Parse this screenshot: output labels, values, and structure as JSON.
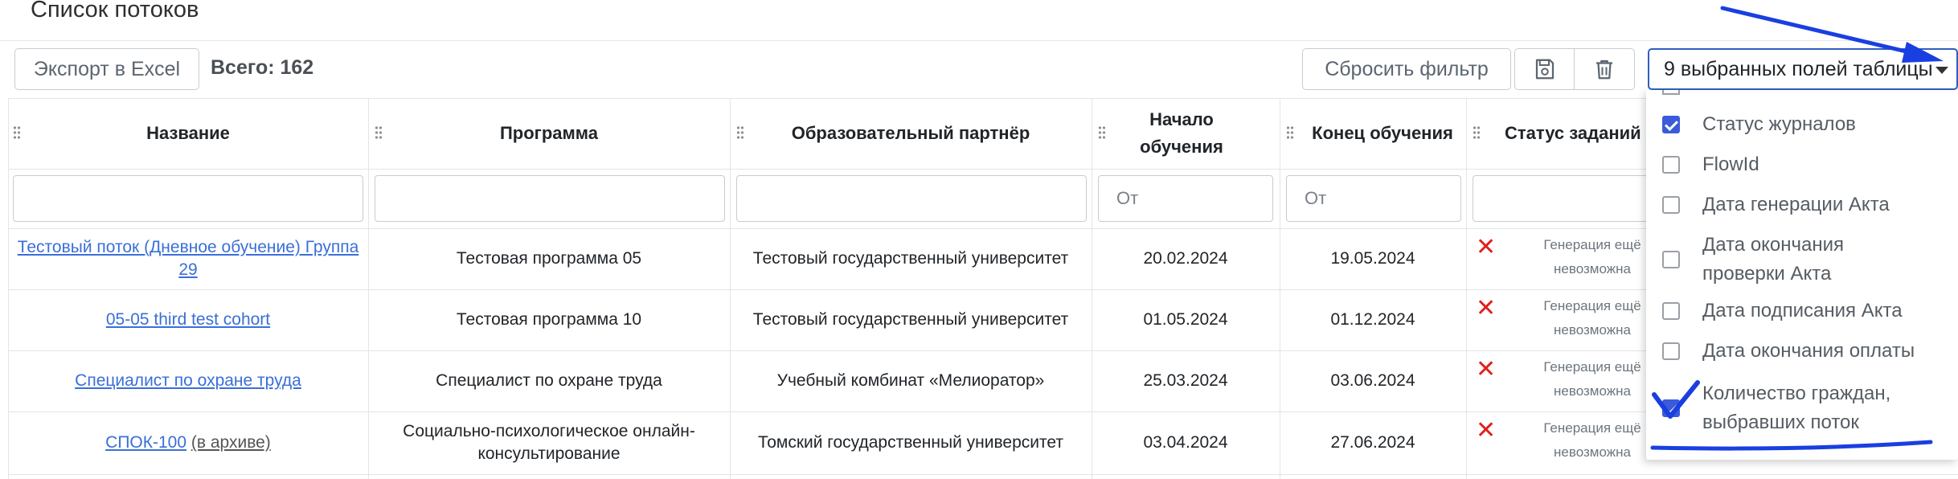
{
  "page": {
    "title": "Список потоков"
  },
  "toolbar": {
    "export_label": "Экспорт в Excel",
    "total_label": "Всего: 162",
    "reset_filter_label": "Сбросить фильтр",
    "save_icon": "floppy-disk-icon",
    "delete_icon": "trash-icon",
    "fields_select_value": "9 выбранных полей таблицы"
  },
  "table": {
    "columns": [
      "Название",
      "Программа",
      "Образовательный партнёр",
      "Начало обучения",
      "Конец обучения",
      "Статус заданий"
    ],
    "filters": {
      "start_placeholder": "От",
      "end_placeholder": "От"
    },
    "rows": [
      {
        "name": "Тестовый поток (Дневное обучение) Группа 29",
        "program": "Тестовая программа 05",
        "partner": "Тестовый государственный университет",
        "start": "20.02.2024",
        "end": "19.05.2024",
        "status": "Генерация ещё невозможна"
      },
      {
        "name": "05-05 third test cohort",
        "program": "Тестовая программа 10",
        "partner": "Тестовый государственный университет",
        "start": "01.05.2024",
        "end": "01.12.2024",
        "status": "Генерация ещё невозможна"
      },
      {
        "name": "Специалист по охране труда",
        "program": "Специалист по охране труда",
        "partner": "Учебный комбинат «Мелиоратор»",
        "start": "25.03.2024",
        "end": "03.06.2024",
        "status": "Генерация ещё невозможна"
      },
      {
        "name": "СПОК-100",
        "name_suffix": "(в архиве)",
        "program": "Социально-психологическое онлайн-консультирование",
        "partner": "Томский государственный университет",
        "start": "03.04.2024",
        "end": "27.06.2024",
        "status": "Генерация ещё невозможна"
      }
    ]
  },
  "dropdown": {
    "options": [
      {
        "label": "Статус журналов",
        "checked": true
      },
      {
        "label": "FlowId",
        "checked": false
      },
      {
        "label": "Дата генерации Акта",
        "checked": false
      },
      {
        "label": "Дата окончания проверки Акта",
        "checked": false
      },
      {
        "label": "Дата подписания Акта",
        "checked": false
      },
      {
        "label": "Дата окончания оплаты",
        "checked": false
      },
      {
        "label": "Количество граждан, выбравших поток",
        "checked": true
      }
    ]
  },
  "colors": {
    "accent": "#3b5bdb",
    "link": "#3a6fd8",
    "error": "#e0201c",
    "annotation": "#1a3fe0"
  }
}
